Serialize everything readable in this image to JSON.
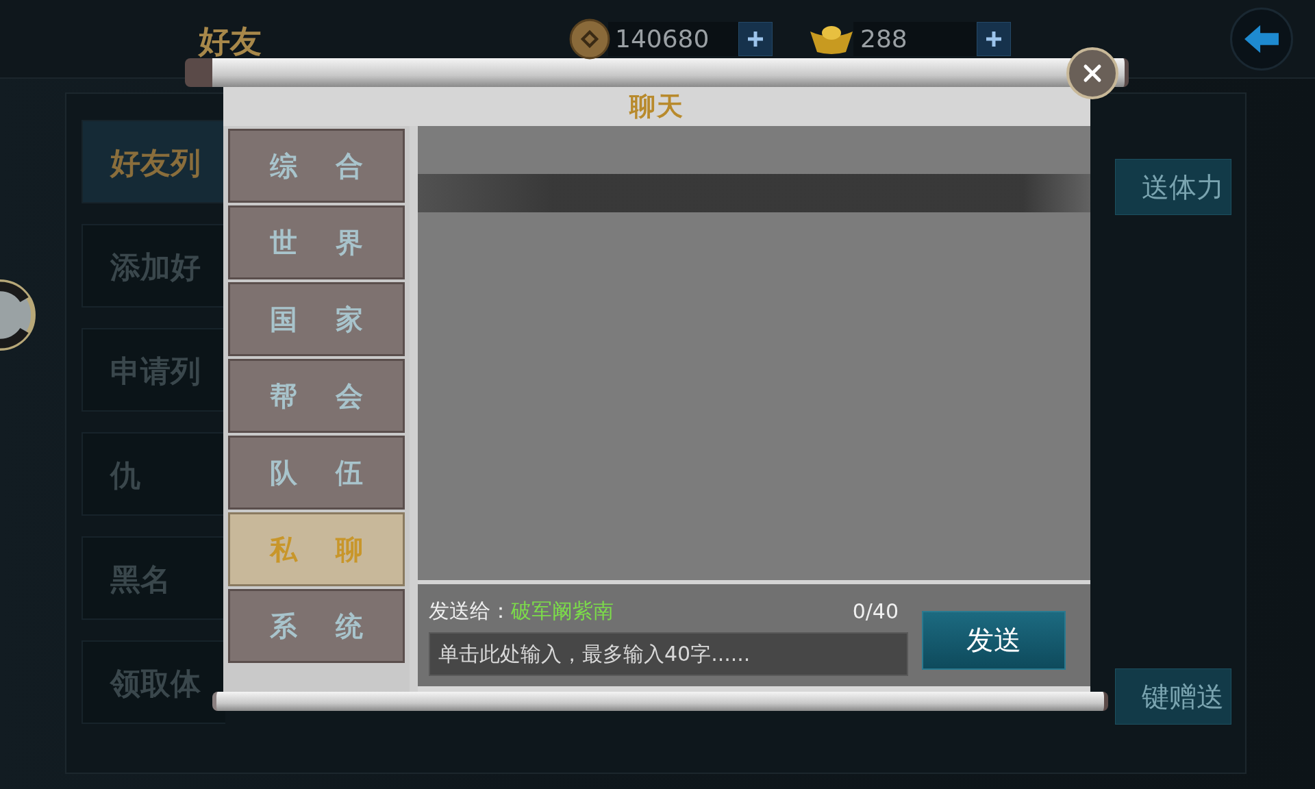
{
  "top_bar": {
    "title": "好友",
    "currencies": [
      {
        "kind": "coin",
        "amount": "140680"
      },
      {
        "kind": "ingot",
        "amount": "288"
      }
    ]
  },
  "friend_menu": [
    {
      "label": "好友列",
      "selected": true
    },
    {
      "label": "添加好",
      "selected": false
    },
    {
      "label": "申请列",
      "selected": false
    },
    {
      "label": "仇",
      "selected": false
    },
    {
      "label": "黑名",
      "selected": false
    },
    {
      "label": "领取体",
      "selected": false
    }
  ],
  "side_buttons": [
    "送体力",
    "键赠送"
  ],
  "chat_dialog": {
    "title": "聊天",
    "channels": [
      {
        "label": "综合",
        "selected": false
      },
      {
        "label": "世界",
        "selected": false
      },
      {
        "label": "国家",
        "selected": false
      },
      {
        "label": "帮会",
        "selected": false
      },
      {
        "label": "队伍",
        "selected": false
      },
      {
        "label": "私聊",
        "selected": true
      },
      {
        "label": "系统",
        "selected": false
      }
    ],
    "compose": {
      "send_to_label": "发送给：",
      "recipient": "破军阚紫南",
      "counter": "0/40",
      "placeholder": "单击此处输入，最多输入40字......",
      "send_button": "发送"
    }
  }
}
